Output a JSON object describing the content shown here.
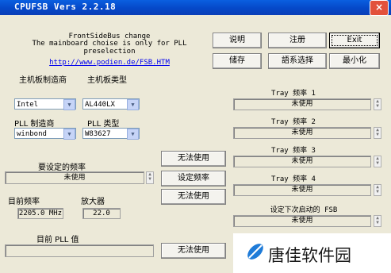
{
  "window": {
    "title": "CPUFSB  Vers 2.2.18",
    "close_label": "×"
  },
  "header": {
    "line1": "FrontSideBus change",
    "line2": "The mainboard choise is only for PLL",
    "line3": "preselection",
    "url": "http://www.podien.de/FSB.HTM"
  },
  "buttons": {
    "explain": "说明",
    "register": "注册",
    "exit": "Exit",
    "save": "储存",
    "language": "語系选择",
    "minimize": "最小化",
    "unused1": "无法使用",
    "set_freq": "设定频率",
    "unused2": "无法使用",
    "unused3": "无法使用"
  },
  "mainboard": {
    "maker_label": "主机板制造商",
    "type_label": "主机板类型",
    "maker_value": "Intel",
    "type_value": "AL440LX"
  },
  "pll": {
    "maker_label": "PLL 制造商",
    "type_label": "PLL 类型",
    "maker_value": "winbond",
    "type_value": "W83627"
  },
  "target": {
    "label": "要设定的频率",
    "value": "未使用"
  },
  "current": {
    "freq_label": "目前频率",
    "mult_label": "放大器",
    "freq_value": "2205.0 MHz",
    "mult_value": "22.0",
    "pll_label": "目前 PLL 值",
    "pll_value": ""
  },
  "tray": [
    {
      "label": "Tray 频率 1",
      "value": "未使用"
    },
    {
      "label": "Tray 频率 2",
      "value": "未使用"
    },
    {
      "label": "Tray 频率 3",
      "value": "未使用"
    },
    {
      "label": "Tray 频率 4",
      "value": "未使用"
    }
  ],
  "next_boot": {
    "label": "设定下次启动的 FSB",
    "value": "未使用"
  },
  "watermark": {
    "text": "唐佳软件园"
  },
  "colors": {
    "titlebar": "#0548c8",
    "window_bg": "#ece9d8",
    "link": "#0000ee",
    "logo": "#1e7bd8"
  },
  "icons": {
    "dropdown": "chevron-down-icon",
    "spin": "spin-arrows-icon",
    "logo": "leaf-logo-icon"
  }
}
